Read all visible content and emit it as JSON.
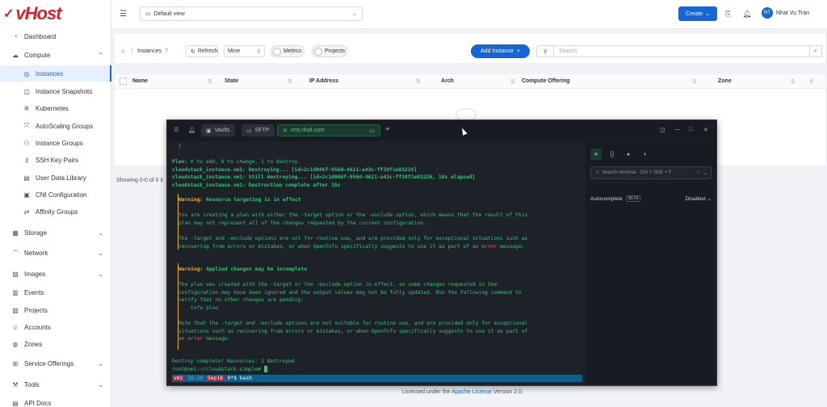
{
  "brand": {
    "logo_text": "vHost",
    "accent": "#1766d6"
  },
  "sidebar": {
    "items": [
      {
        "label": "Dashboard",
        "icon": "dashboard-icon"
      },
      {
        "label": "Compute",
        "icon": "cloud-icon"
      },
      {
        "label": "Instances",
        "icon": "instance-icon"
      },
      {
        "label": "Instance Snapshots",
        "icon": "snapshot-icon"
      },
      {
        "label": "Kubernetes",
        "icon": "kubernetes-icon"
      },
      {
        "label": "AutoScaling Groups",
        "icon": "autoscale-icon"
      },
      {
        "label": "Instance Groups",
        "icon": "group-icon"
      },
      {
        "label": "SSH Key Pairs",
        "icon": "key-icon"
      },
      {
        "label": "User Data Library",
        "icon": "library-icon"
      },
      {
        "label": "CNI Configuration",
        "icon": "cni-icon"
      },
      {
        "label": "Affinity Groups",
        "icon": "affinity-icon"
      },
      {
        "label": "Storage",
        "icon": "storage-icon"
      },
      {
        "label": "Network",
        "icon": "network-icon"
      },
      {
        "label": "Images",
        "icon": "images-icon"
      },
      {
        "label": "Events",
        "icon": "events-icon"
      },
      {
        "label": "Projects",
        "icon": "projects-icon"
      },
      {
        "label": "Accounts",
        "icon": "accounts-icon"
      },
      {
        "label": "Zones",
        "icon": "zones-icon"
      },
      {
        "label": "Service Offerings",
        "icon": "offerings-icon"
      },
      {
        "label": "Tools",
        "icon": "tools-icon"
      },
      {
        "label": "API Docs",
        "icon": "api-docs-icon"
      }
    ]
  },
  "topbar": {
    "view": "Default view",
    "create": "Create",
    "avatar_initials": "NT",
    "username": "Nhat Vu Tran"
  },
  "toolbar": {
    "breadcrumb": "Instances",
    "refresh": "Refresh",
    "mine": "Mine",
    "metrics": "Metrics",
    "projects": "Projects",
    "add_instance": "Add Instance",
    "search_placeholder": "Search"
  },
  "table": {
    "columns": [
      "Name",
      "State",
      "IP Address",
      "Arch",
      "Compute Offering",
      "Zone"
    ]
  },
  "showing": "Showing 0-0 of 0 it",
  "license": {
    "prefix": "Licensed under the ",
    "link": "Apache License",
    "suffix": " Version 2.0."
  },
  "terminal": {
    "tabs": [
      {
        "label": "Vaults"
      },
      {
        "label": "SFTP"
      },
      {
        "label": "vmt.nhat.com"
      }
    ],
    "lines": {
      "l0": "  }",
      "l1a": "Plan:",
      "l1b": " 0 to add, 0 to change, 1 to destroy.",
      "l2": "cloudstack_instance.vm1: Destroying... [id=2c1d006f-956d-4621-a43c-ff38f1e83226]",
      "l3": "cloudstack_instance.vm1: Still destroying... [id=2c1d006f-956d-4621-a43c-ff38f1e83226, 10s elapsed]",
      "l4": "cloudstack_instance.vm1: Destruction complete after 15s",
      "w1a": "Warning:",
      "w1b": " Resource targeting is in effect",
      "w1c": "You are creating a plan with either the -target option or the -exclude option, which means that the result of this",
      "w1d": "plan may not represent all of the changes requested by the current configuration.",
      "w1e": "The -target and -exclude options are not for routine use, and are provided only for exceptional situations such as",
      "w1f": "recovering from errors or mistakes, or when OpenTofu specifically suggests to use it as part of an ",
      "w1err": "error",
      "w1g": " message.",
      "w2a": "Warning:",
      "w2b": " Applied changes may be incomplete",
      "w2c": "The plan was created with the -target or the -exclude option in effect, so some changes requested in the",
      "w2d": "configuration may have been ignored and the output values may not be fully updated. Run the following command to",
      "w2e": "verify that no other changes are pending:",
      "w2f": "    tofu plan",
      "w2g": "Note that the -target and -exclude options are not suitable for routine use, and are provided only for exceptional",
      "w2h": "situations such as recovering from errors or mistakes, or when OpenTofu specifically suggests to use it as part of",
      "w2i": "an ",
      "w2err": "error",
      "w2j": " message.",
      "l5": "Destroy complete! Resources: 1 destroyed.",
      "l6": "root@vm1:~/cloudstack-simple# "
    },
    "status": {
      "host": "vm1",
      "time": "16:20",
      "date": "Sep18",
      "win": "0*$ bash"
    },
    "side": {
      "search_placeholder": "Search terminal - Ctrl + Shift + F",
      "autocomplete": "Autocomplete",
      "beta": "BETA",
      "mode": "Disabled"
    }
  }
}
